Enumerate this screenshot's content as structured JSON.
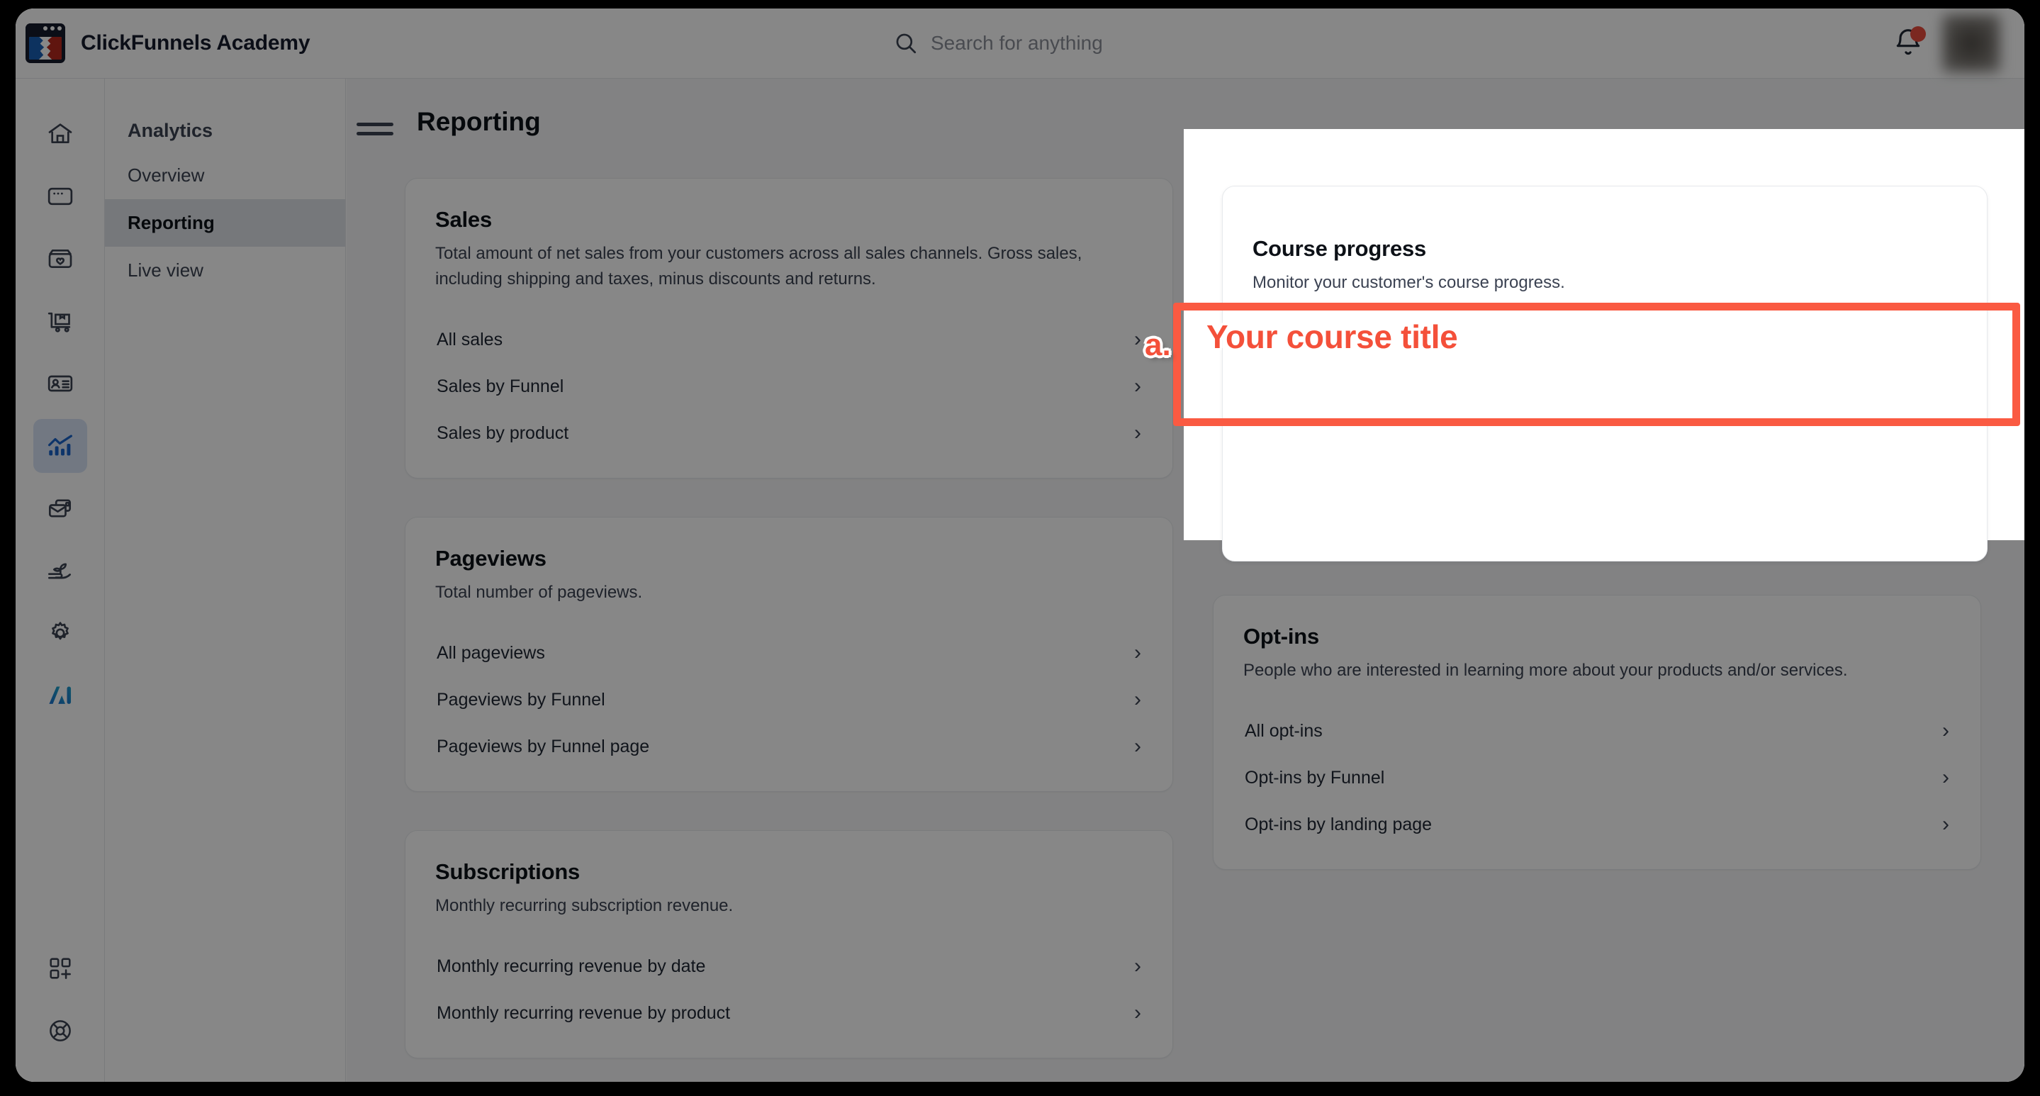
{
  "header": {
    "brand_title": "ClickFunnels Academy",
    "logo_icon": "clickfunnels-logo-icon",
    "search": {
      "icon": "search-icon",
      "placeholder": "Search for anything",
      "value": ""
    },
    "notifications": {
      "icon": "bell-icon",
      "has_unread_dot": true,
      "dot_color": "#e84c3d"
    },
    "avatar": {
      "icon": "avatar",
      "blurred": true
    }
  },
  "rail": {
    "items": [
      {
        "icon": "home-icon",
        "name": "home",
        "active": false
      },
      {
        "icon": "browser-window-icon",
        "name": "funnels",
        "active": false
      },
      {
        "icon": "product-box-heart-icon",
        "name": "products",
        "active": false
      },
      {
        "icon": "delivery-cart-icon",
        "name": "orders",
        "active": false
      },
      {
        "icon": "contact-card-icon",
        "name": "contacts",
        "active": false
      },
      {
        "icon": "analytics-bar-chart-icon",
        "name": "analytics",
        "active": true
      },
      {
        "icon": "mail-card-icon",
        "name": "marketing",
        "active": false
      },
      {
        "icon": "plant-in-hand-icon",
        "name": "growth",
        "active": false
      },
      {
        "icon": "gear-icon",
        "name": "settings",
        "active": false
      },
      {
        "icon": "ai-icon",
        "name": "ai",
        "active": false
      }
    ],
    "bottom_items": [
      {
        "icon": "apps-plus-icon",
        "name": "apps"
      },
      {
        "icon": "lifebuoy-help-icon",
        "name": "help"
      }
    ],
    "active_accent": "#1a63c9",
    "active_bg": "#d7e3f5"
  },
  "subnav": {
    "title": "Analytics",
    "items": [
      {
        "label": "Overview",
        "active": false
      },
      {
        "label": "Reporting",
        "active": true
      },
      {
        "label": "Live view",
        "active": false
      }
    ]
  },
  "main": {
    "menu_icon": "hamburger-menu-icon",
    "page_title": "Reporting",
    "cards": [
      {
        "title": "Sales",
        "description": "Total amount of net sales from your customers across all sales channels. Gross sales, including shipping and taxes, minus discounts and returns.",
        "links": [
          "All sales",
          "Sales by Funnel",
          "Sales by product"
        ]
      },
      {
        "title": "Pageviews",
        "description": "Total number of pageviews.",
        "links": [
          "All pageviews",
          "Pageviews by Funnel",
          "Pageviews by Funnel page"
        ]
      },
      {
        "title": "Subscriptions",
        "description": "Monthly recurring subscription revenue.",
        "links": [
          "Monthly recurring revenue by date",
          "Monthly recurring revenue by product"
        ]
      },
      {
        "title": "Opt-ins",
        "description": "People who are interested in learning more about your products and/or services.",
        "links": [
          "All opt-ins",
          "Opt-ins by Funnel",
          "Opt-ins by landing page"
        ]
      }
    ],
    "chevron_icon": "chevron-right-icon"
  },
  "spotlight": {
    "card": {
      "title": "Course progress",
      "description": "Monitor your customer's course progress."
    }
  },
  "annotation": {
    "letter": "a.",
    "text": "Your course title",
    "color": "#fa5a42",
    "outline_color": "#ffffff"
  }
}
